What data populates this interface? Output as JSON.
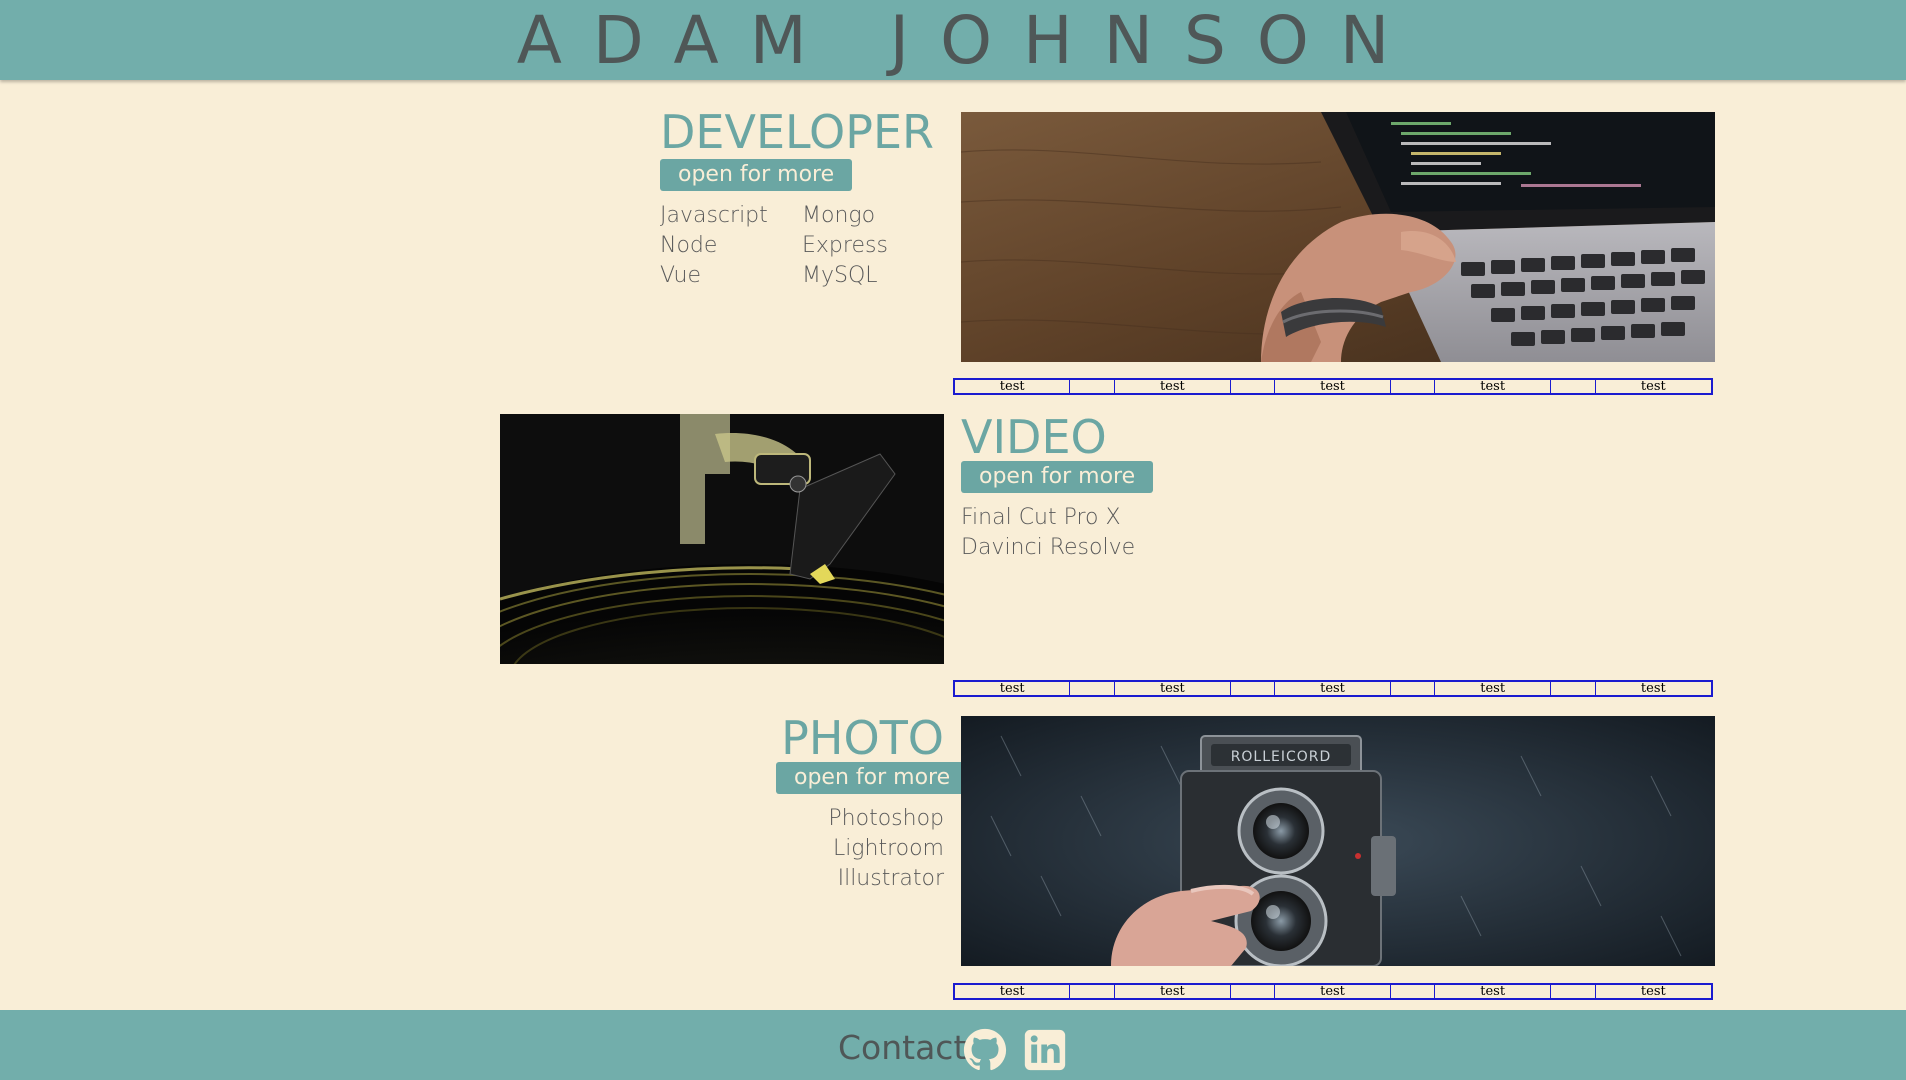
{
  "header": {
    "title": "ADAM JOHNSON"
  },
  "sections": [
    {
      "title": "DEVELOPER",
      "button": "open for more",
      "skills_col1": [
        "Javascript",
        "Node",
        "Vue"
      ],
      "skills_col2": [
        "Mongo",
        "Express",
        "MySQL"
      ],
      "image": "laptop-coding-photo"
    },
    {
      "title": "VIDEO",
      "button": "open for more",
      "skills": [
        "Final Cut Pro X",
        "Davinci Resolve"
      ],
      "image": "turntable-photo"
    },
    {
      "title": "PHOTO",
      "button": "open for more",
      "skills": [
        "Photoshop",
        "Lightroom",
        "Illustrator"
      ],
      "image": "rolleicord-camera-photo"
    }
  ],
  "test_bars": [
    [
      "test",
      "",
      "test",
      "",
      "test",
      "",
      "test",
      "",
      "test"
    ],
    [
      "test",
      "",
      "test",
      "",
      "test",
      "",
      "test",
      "",
      "test"
    ],
    [
      "test",
      "",
      "test",
      "",
      "test",
      "",
      "test",
      "",
      "test"
    ]
  ],
  "footer": {
    "contact_label": "Contact",
    "icons": [
      "github-icon",
      "linkedin-icon"
    ]
  },
  "colors": {
    "background": "#f9eed7",
    "accent": "#72aeab",
    "title_text": "#4f5757",
    "heading": "#6ba6a3",
    "test_border": "#1b1bcf"
  }
}
